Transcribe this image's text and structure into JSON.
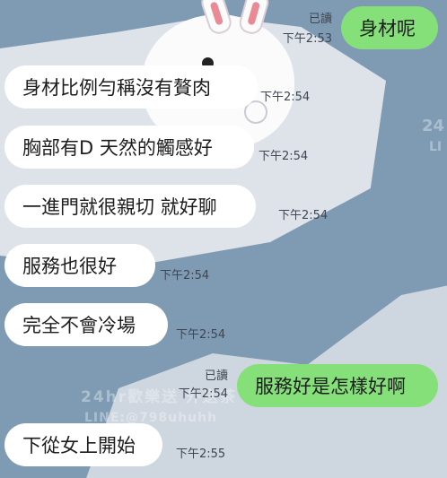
{
  "messages": [
    {
      "dir": "out",
      "text": "身材呢",
      "read": "已讀",
      "time": "下午2:53"
    },
    {
      "dir": "in",
      "text": "身材比例勻稱沒有贅肉",
      "time": "下午2:54"
    },
    {
      "dir": "in",
      "text": "胸部有D 天然的觸感好",
      "time": "下午2:54"
    },
    {
      "dir": "in",
      "text": "一進門就很親切 就好聊",
      "time": "下午2:54"
    },
    {
      "dir": "in",
      "text": "服務也很好",
      "time": "下午2:54"
    },
    {
      "dir": "in",
      "text": "完全不會冷場",
      "time": "下午2:54"
    },
    {
      "dir": "out",
      "text": "服務好是怎樣好啊",
      "read": "已讀",
      "time": "下午2:54"
    },
    {
      "dir": "in",
      "text": "下從女上開始",
      "time": "下午2:55"
    }
  ],
  "watermark": {
    "line1": "24hr歡樂送 外送茶",
    "line2": "LINE:@798uhuhh",
    "side1": "24",
    "side2": "LI"
  },
  "colors": {
    "background": "#7f9bb4",
    "incoming_bubble": "#ffffff",
    "outgoing_bubble": "#85e07a"
  }
}
